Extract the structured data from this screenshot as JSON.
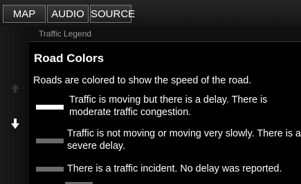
{
  "tabs": [
    {
      "label": "MAP"
    },
    {
      "label": "AUDIO"
    },
    {
      "label": "SOURCE"
    }
  ],
  "panel": {
    "header": "Traffic Legend",
    "title": "Road Colors",
    "intro": "Roads are colored to show the speed of the road."
  },
  "legend": [
    {
      "color": "#ffffff",
      "text": "Traffic is moving but there is a delay. There is moderate traffic congestion."
    },
    {
      "color": "#6a6a6a",
      "text": "Traffic is not moving or moving very slowly. There is a severe delay."
    },
    {
      "color": "#6a6a6a",
      "text": "There is a traffic incident. No delay was reported."
    }
  ],
  "icons": {
    "scroll_up": "arrow-up-icon",
    "scroll_down": "arrow-down-icon"
  }
}
